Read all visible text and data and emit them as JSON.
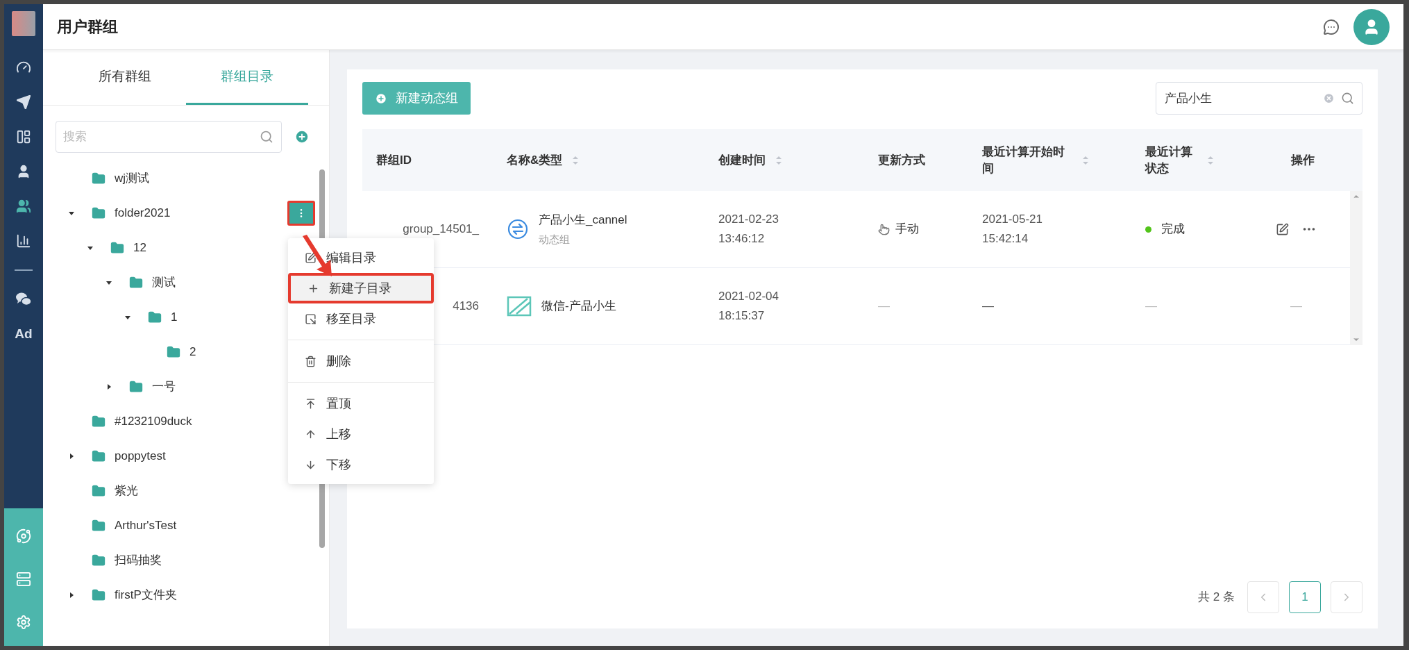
{
  "header": {
    "title": "用户群组"
  },
  "sidebar": {
    "items": [
      {
        "kind": "gauge",
        "selected": false
      },
      {
        "kind": "send",
        "selected": false
      },
      {
        "kind": "layout",
        "selected": false
      },
      {
        "kind": "user",
        "selected": false
      },
      {
        "kind": "users",
        "selected": true
      },
      {
        "kind": "chart",
        "selected": false
      },
      {
        "kind": "divider"
      },
      {
        "kind": "wechat",
        "selected": false
      },
      {
        "kind": "text",
        "label": "Ad",
        "selected": false
      }
    ],
    "bottom_items": [
      {
        "kind": "hub"
      },
      {
        "kind": "server"
      },
      {
        "kind": "settings"
      }
    ]
  },
  "panel_tabs": [
    {
      "label": "所有群组",
      "selected": false
    },
    {
      "label": "群组目录",
      "selected": true
    }
  ],
  "tree_search": {
    "placeholder": "搜索"
  },
  "tree": [
    {
      "label": "wj测试"
    },
    {
      "label": "folder2021",
      "expanded": true,
      "menu_open": true,
      "children": [
        {
          "label": "12",
          "expanded": true,
          "children": [
            {
              "label": "测试",
              "expanded": true,
              "children": [
                {
                  "label": "1",
                  "expanded": true,
                  "children": [
                    {
                      "label": "2"
                    }
                  ]
                }
              ]
            },
            {
              "label": "一号",
              "expanded": false
            }
          ]
        }
      ]
    },
    {
      "label": "#1232109duck"
    },
    {
      "label": "poppytest",
      "expanded": false
    },
    {
      "label": "紫光"
    },
    {
      "label": "Arthur'sTest"
    },
    {
      "label": "扫码抽奖"
    },
    {
      "label": "firstP文件夹",
      "expanded": false
    }
  ],
  "context_menu": [
    {
      "kind": "edit",
      "label": "编辑目录",
      "highlighted": false,
      "annotated": false
    },
    {
      "kind": "plus",
      "label": "新建子目录",
      "highlighted": true,
      "annotated": true
    },
    {
      "kind": "move",
      "label": "移至目录",
      "highlighted": false,
      "annotated": false
    },
    {
      "kind": "divider"
    },
    {
      "kind": "trash",
      "label": "删除",
      "highlighted": false,
      "annotated": false
    },
    {
      "kind": "divider"
    },
    {
      "kind": "top",
      "label": "置顶",
      "highlighted": false,
      "annotated": false
    },
    {
      "kind": "up",
      "label": "上移",
      "highlighted": false,
      "annotated": false
    },
    {
      "kind": "down",
      "label": "下移",
      "highlighted": false,
      "annotated": false
    }
  ],
  "new_button": {
    "label": "新建动态组"
  },
  "main_search": {
    "value": "产品小生"
  },
  "table": {
    "columns": [
      {
        "label": "群组ID",
        "sortable": false
      },
      {
        "label": "名称&类型",
        "sortable": true
      },
      {
        "label": "创建时间",
        "sortable": true
      },
      {
        "label": "更新方式",
        "sortable": false
      },
      {
        "label": "最近计算开始时间",
        "sortable": true
      },
      {
        "label": "最近计算状态",
        "sortable": true
      },
      {
        "label": "操作",
        "sortable": false
      }
    ],
    "rows": [
      {
        "id": "group_14501_",
        "kind": "dynamic",
        "name": "产品小生_cannel",
        "type": "动态组",
        "created": [
          "2021-02-23",
          "13:46:12"
        ],
        "update": {
          "kind": "manual",
          "text": "手动"
        },
        "calc": [
          "2021-05-21",
          "15:42:14"
        ],
        "status": {
          "text": "完成",
          "color": "#52c41a"
        },
        "actions": {
          "kind": "buttons"
        }
      },
      {
        "id": "4136",
        "kind": "wechat",
        "name": "微信-产品小生",
        "created": [
          "2021-02-04",
          "18:15:37"
        ],
        "update": {
          "kind": "none",
          "text": "—"
        },
        "calc": [
          "—"
        ],
        "status": {
          "text": "—"
        },
        "actions": {
          "kind": "text",
          "text": "—"
        }
      }
    ]
  },
  "pagination": {
    "total": "共 2 条",
    "pages": [
      {
        "label": "1",
        "selected": true
      }
    ]
  }
}
